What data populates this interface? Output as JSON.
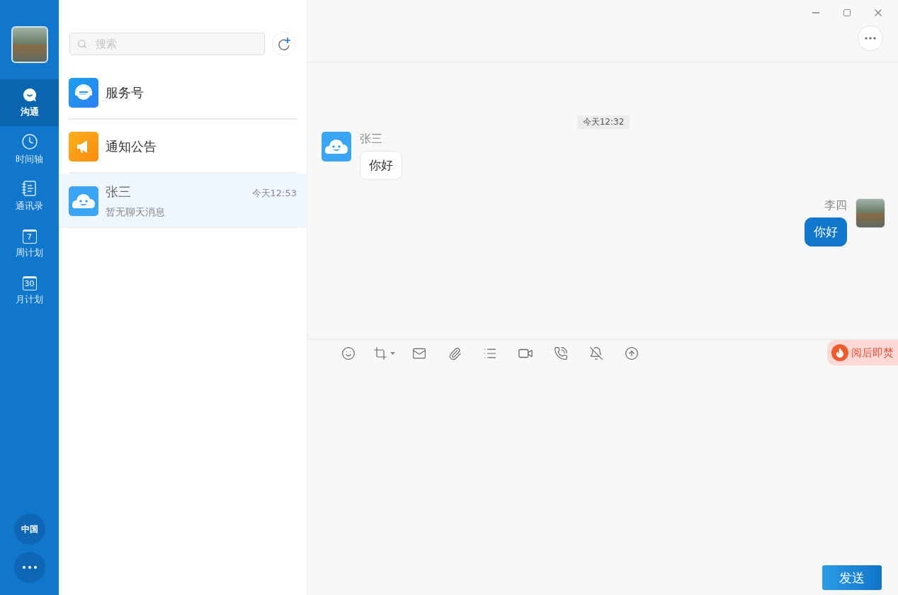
{
  "sidebar": {
    "nav": [
      {
        "label": "沟通",
        "kind": "chat",
        "selected": true
      },
      {
        "label": "时间轴",
        "kind": "clock",
        "selected": false
      },
      {
        "label": "通讯录",
        "kind": "book",
        "selected": false
      },
      {
        "label": "周计划",
        "kind": "calendar",
        "day": "7",
        "selected": false
      },
      {
        "label": "月计划",
        "kind": "calendar",
        "day": "30",
        "selected": false
      }
    ],
    "region_button": "中国"
  },
  "list": {
    "search": {
      "placeholder": "搜索"
    },
    "items": [
      {
        "kind": "service",
        "name": "服务号",
        "selected": false
      },
      {
        "kind": "notice",
        "name": "通知公告",
        "selected": false
      },
      {
        "kind": "contact",
        "name": "张三",
        "time": "今天12:53",
        "preview": "暂无聊天消息",
        "selected": true
      }
    ]
  },
  "chat": {
    "time_divider": "今天12:32",
    "messages": [
      {
        "sender": "张三",
        "text": "你好",
        "outgoing": false
      },
      {
        "sender": "李四",
        "text": "你好",
        "outgoing": true
      }
    ],
    "burn_after_reading": "阅后即焚",
    "send_button": "发送"
  }
}
